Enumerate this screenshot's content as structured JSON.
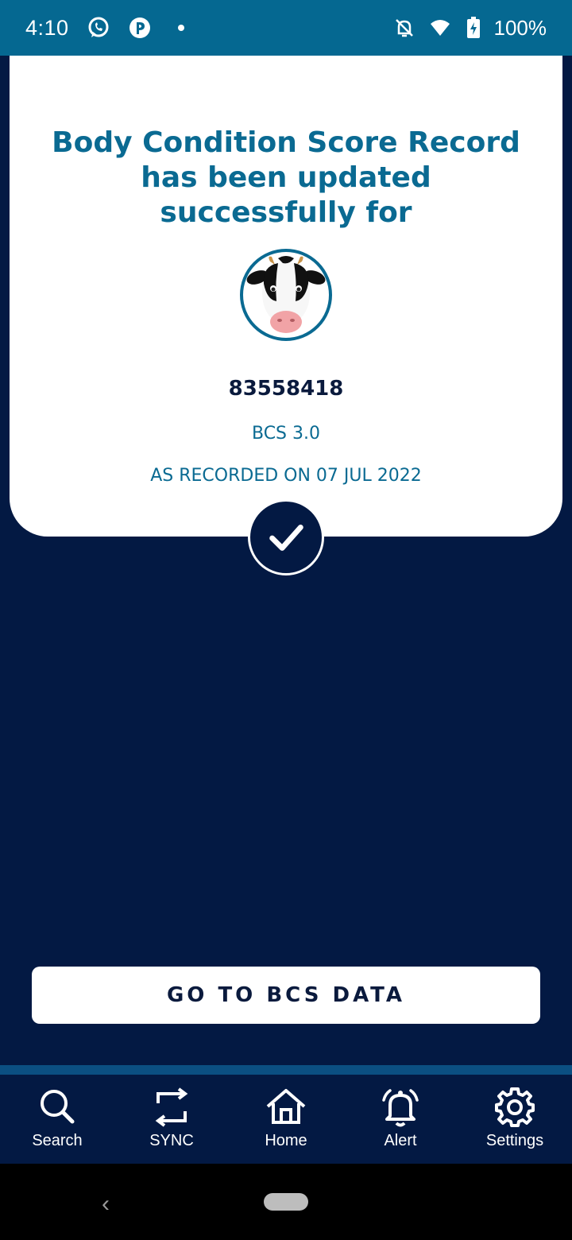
{
  "status_bar": {
    "time": "4:10",
    "battery": "100%",
    "icons": [
      "whatsapp-icon",
      "pinterest-icon",
      "notification-dot-icon",
      "bell-off-icon",
      "wifi-5-icon",
      "battery-charging-icon"
    ]
  },
  "card": {
    "headline": "Body Condition Score Record has been updated successfully for",
    "animal_icon": "cow-face-icon",
    "animal_id": "83558418",
    "bcs": "BCS 3.0",
    "recorded": "AS RECORDED ON 07 JUL 2022",
    "success_icon": "checkmark-icon"
  },
  "cta": {
    "label": "GO TO BCS DATA"
  },
  "bottom_nav": {
    "items": [
      {
        "label": "Search",
        "icon": "search-icon"
      },
      {
        "label": "SYNC",
        "icon": "sync-icon"
      },
      {
        "label": "Home",
        "icon": "home-icon"
      },
      {
        "label": "Alert",
        "icon": "alert-bell-icon"
      },
      {
        "label": "Settings",
        "icon": "gear-icon"
      }
    ]
  },
  "colors": {
    "status_bar": "#056891",
    "background": "#031943",
    "accent": "#0a6a92",
    "card": "#ffffff"
  }
}
